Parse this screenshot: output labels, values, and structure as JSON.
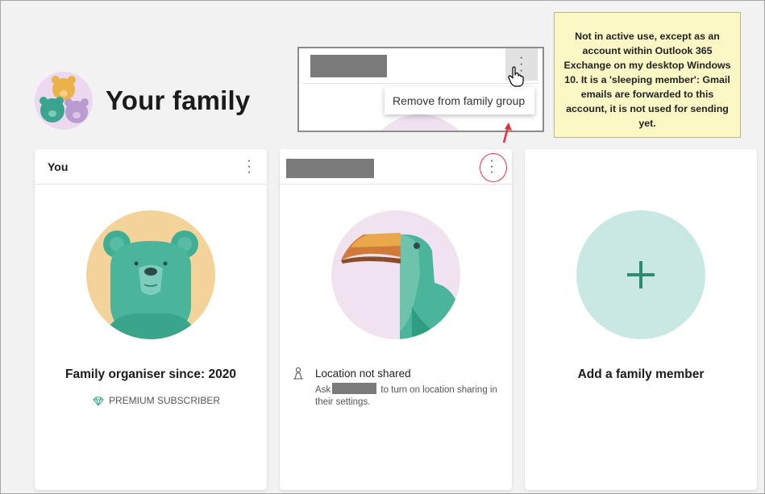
{
  "header": {
    "title": "Your family",
    "avatar_icon": "family-bears-icon"
  },
  "callout": {
    "menu_item": "Remove from family group"
  },
  "note": {
    "text": "Not in active use, except as an account within Outlook 365 Exchange on my desktop Windows 10. It is a 'sleeping member': Gmail emails are forwarded to this account, it is not used for sending yet."
  },
  "cards": {
    "you": {
      "header_label": "You",
      "organiser_text": "Family organiser since: 2020",
      "badge_label": "PREMIUM SUBSCRIBER"
    },
    "member": {
      "location_title": "Location not shared",
      "location_ask": "Ask",
      "location_rest": "to turn on location sharing in their settings."
    },
    "add": {
      "label": "Add a family member"
    }
  },
  "colors": {
    "accent_teal": "#2f8a73",
    "annotation_red": "#e0323b",
    "note_bg": "#fbf8c6"
  }
}
